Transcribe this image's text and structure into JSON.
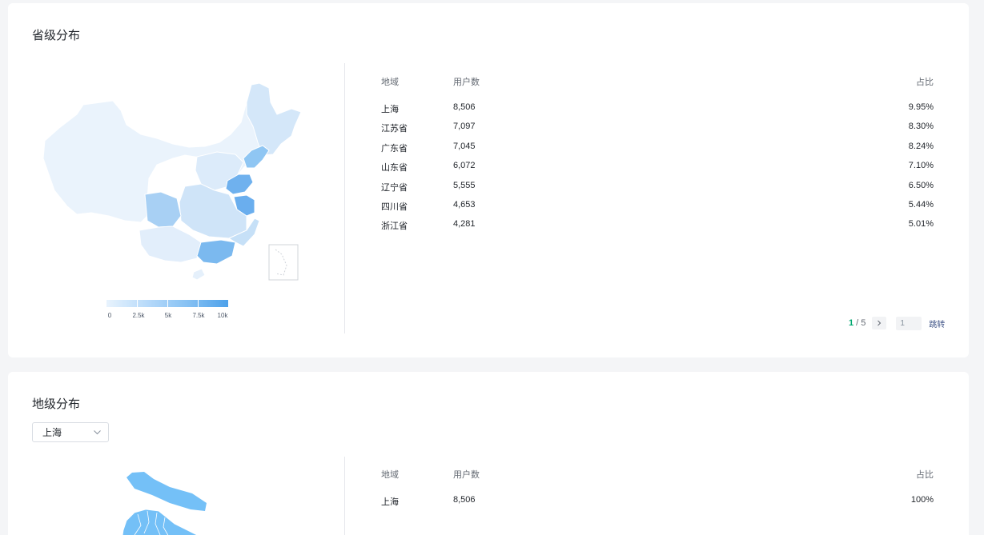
{
  "province_section": {
    "title": "省级分布",
    "legend": {
      "labels": [
        "0",
        "2.5k",
        "5k",
        "7.5k",
        "10k"
      ]
    },
    "table": {
      "headers": {
        "region": "地域",
        "users": "用户数",
        "share": "占比"
      },
      "rows": [
        {
          "region": "上海",
          "users": "8,506",
          "share": "9.95%"
        },
        {
          "region": "江苏省",
          "users": "7,097",
          "share": "8.30%"
        },
        {
          "region": "广东省",
          "users": "7,045",
          "share": "8.24%"
        },
        {
          "region": "山东省",
          "users": "6,072",
          "share": "7.10%"
        },
        {
          "region": "辽宁省",
          "users": "5,555",
          "share": "6.50%"
        },
        {
          "region": "四川省",
          "users": "4,653",
          "share": "5.44%"
        },
        {
          "region": "浙江省",
          "users": "4,281",
          "share": "5.01%"
        }
      ]
    },
    "pagination": {
      "current": "1",
      "separator": "/",
      "total": "5",
      "next_icon": "chevron-right-icon",
      "jump_input_value": "1",
      "jump_label": "跳转"
    }
  },
  "city_section": {
    "title": "地级分布",
    "select": {
      "value": "上海",
      "icon": "chevron-down-icon"
    },
    "table": {
      "headers": {
        "region": "地域",
        "users": "用户数",
        "share": "占比"
      },
      "rows": [
        {
          "region": "上海",
          "users": "8,506",
          "share": "100%"
        }
      ]
    }
  },
  "colors": {
    "map_scale": [
      "#e8f3fd",
      "#b7dafa",
      "#86c1f3",
      "#4da1ea"
    ],
    "pager_current": "#00a870",
    "city_map_fill": "#74c0f7"
  }
}
